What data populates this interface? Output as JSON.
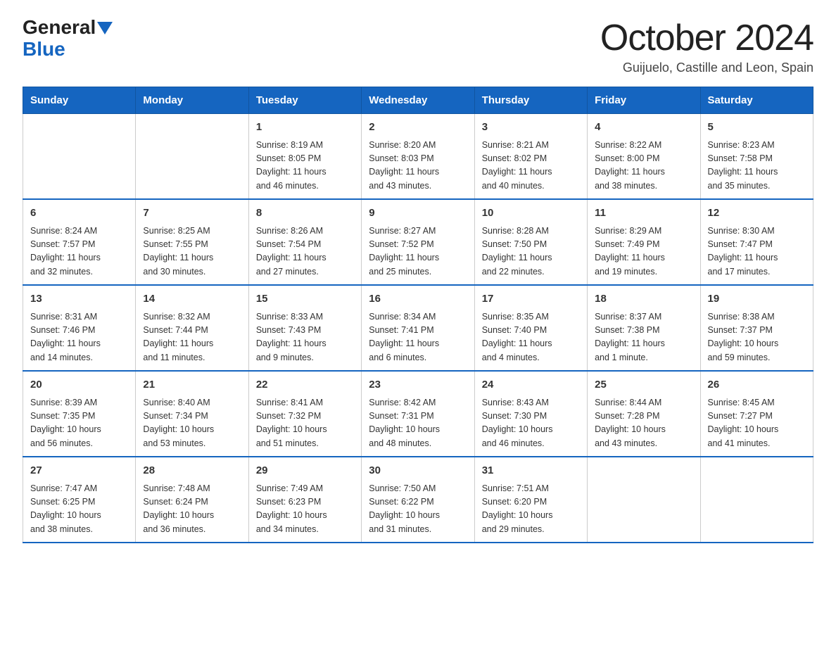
{
  "logo": {
    "part1": "General",
    "part2": "Blue"
  },
  "title": "October 2024",
  "subtitle": "Guijuelo, Castille and Leon, Spain",
  "weekdays": [
    "Sunday",
    "Monday",
    "Tuesday",
    "Wednesday",
    "Thursday",
    "Friday",
    "Saturday"
  ],
  "weeks": [
    [
      {
        "day": "",
        "info": ""
      },
      {
        "day": "",
        "info": ""
      },
      {
        "day": "1",
        "info": "Sunrise: 8:19 AM\nSunset: 8:05 PM\nDaylight: 11 hours\nand 46 minutes."
      },
      {
        "day": "2",
        "info": "Sunrise: 8:20 AM\nSunset: 8:03 PM\nDaylight: 11 hours\nand 43 minutes."
      },
      {
        "day": "3",
        "info": "Sunrise: 8:21 AM\nSunset: 8:02 PM\nDaylight: 11 hours\nand 40 minutes."
      },
      {
        "day": "4",
        "info": "Sunrise: 8:22 AM\nSunset: 8:00 PM\nDaylight: 11 hours\nand 38 minutes."
      },
      {
        "day": "5",
        "info": "Sunrise: 8:23 AM\nSunset: 7:58 PM\nDaylight: 11 hours\nand 35 minutes."
      }
    ],
    [
      {
        "day": "6",
        "info": "Sunrise: 8:24 AM\nSunset: 7:57 PM\nDaylight: 11 hours\nand 32 minutes."
      },
      {
        "day": "7",
        "info": "Sunrise: 8:25 AM\nSunset: 7:55 PM\nDaylight: 11 hours\nand 30 minutes."
      },
      {
        "day": "8",
        "info": "Sunrise: 8:26 AM\nSunset: 7:54 PM\nDaylight: 11 hours\nand 27 minutes."
      },
      {
        "day": "9",
        "info": "Sunrise: 8:27 AM\nSunset: 7:52 PM\nDaylight: 11 hours\nand 25 minutes."
      },
      {
        "day": "10",
        "info": "Sunrise: 8:28 AM\nSunset: 7:50 PM\nDaylight: 11 hours\nand 22 minutes."
      },
      {
        "day": "11",
        "info": "Sunrise: 8:29 AM\nSunset: 7:49 PM\nDaylight: 11 hours\nand 19 minutes."
      },
      {
        "day": "12",
        "info": "Sunrise: 8:30 AM\nSunset: 7:47 PM\nDaylight: 11 hours\nand 17 minutes."
      }
    ],
    [
      {
        "day": "13",
        "info": "Sunrise: 8:31 AM\nSunset: 7:46 PM\nDaylight: 11 hours\nand 14 minutes."
      },
      {
        "day": "14",
        "info": "Sunrise: 8:32 AM\nSunset: 7:44 PM\nDaylight: 11 hours\nand 11 minutes."
      },
      {
        "day": "15",
        "info": "Sunrise: 8:33 AM\nSunset: 7:43 PM\nDaylight: 11 hours\nand 9 minutes."
      },
      {
        "day": "16",
        "info": "Sunrise: 8:34 AM\nSunset: 7:41 PM\nDaylight: 11 hours\nand 6 minutes."
      },
      {
        "day": "17",
        "info": "Sunrise: 8:35 AM\nSunset: 7:40 PM\nDaylight: 11 hours\nand 4 minutes."
      },
      {
        "day": "18",
        "info": "Sunrise: 8:37 AM\nSunset: 7:38 PM\nDaylight: 11 hours\nand 1 minute."
      },
      {
        "day": "19",
        "info": "Sunrise: 8:38 AM\nSunset: 7:37 PM\nDaylight: 10 hours\nand 59 minutes."
      }
    ],
    [
      {
        "day": "20",
        "info": "Sunrise: 8:39 AM\nSunset: 7:35 PM\nDaylight: 10 hours\nand 56 minutes."
      },
      {
        "day": "21",
        "info": "Sunrise: 8:40 AM\nSunset: 7:34 PM\nDaylight: 10 hours\nand 53 minutes."
      },
      {
        "day": "22",
        "info": "Sunrise: 8:41 AM\nSunset: 7:32 PM\nDaylight: 10 hours\nand 51 minutes."
      },
      {
        "day": "23",
        "info": "Sunrise: 8:42 AM\nSunset: 7:31 PM\nDaylight: 10 hours\nand 48 minutes."
      },
      {
        "day": "24",
        "info": "Sunrise: 8:43 AM\nSunset: 7:30 PM\nDaylight: 10 hours\nand 46 minutes."
      },
      {
        "day": "25",
        "info": "Sunrise: 8:44 AM\nSunset: 7:28 PM\nDaylight: 10 hours\nand 43 minutes."
      },
      {
        "day": "26",
        "info": "Sunrise: 8:45 AM\nSunset: 7:27 PM\nDaylight: 10 hours\nand 41 minutes."
      }
    ],
    [
      {
        "day": "27",
        "info": "Sunrise: 7:47 AM\nSunset: 6:25 PM\nDaylight: 10 hours\nand 38 minutes."
      },
      {
        "day": "28",
        "info": "Sunrise: 7:48 AM\nSunset: 6:24 PM\nDaylight: 10 hours\nand 36 minutes."
      },
      {
        "day": "29",
        "info": "Sunrise: 7:49 AM\nSunset: 6:23 PM\nDaylight: 10 hours\nand 34 minutes."
      },
      {
        "day": "30",
        "info": "Sunrise: 7:50 AM\nSunset: 6:22 PM\nDaylight: 10 hours\nand 31 minutes."
      },
      {
        "day": "31",
        "info": "Sunrise: 7:51 AM\nSunset: 6:20 PM\nDaylight: 10 hours\nand 29 minutes."
      },
      {
        "day": "",
        "info": ""
      },
      {
        "day": "",
        "info": ""
      }
    ]
  ]
}
